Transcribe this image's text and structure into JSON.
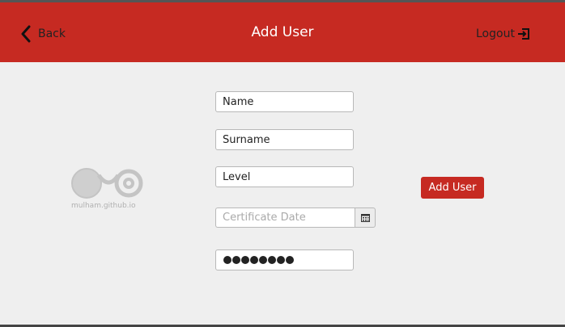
{
  "header": {
    "back_label": "Back",
    "title": "Add User",
    "logout_label": "Logout"
  },
  "form": {
    "name_value": "Name",
    "surname_value": "Surname",
    "level_value": "Level",
    "certificate_date_placeholder": "Certificate Date",
    "password_masked_length": 8,
    "submit_label": "Add User"
  },
  "watermark": {
    "text": "mulham.github.io"
  },
  "colors": {
    "header_bg": "#c62a22",
    "button_bg": "#c62a22",
    "page_bg": "#efefef"
  },
  "icons": {
    "back": "chevron-left-icon",
    "logout": "logout-icon",
    "calendar": "calendar-icon",
    "logo": "infinity-logo-icon"
  }
}
